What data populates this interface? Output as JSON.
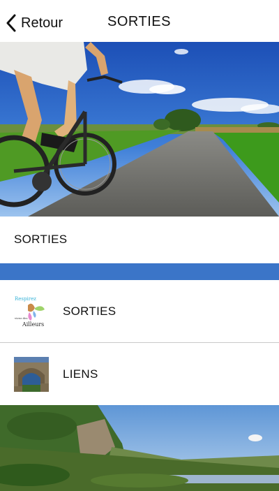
{
  "header": {
    "back_label": "Retour",
    "title": "SORTIES"
  },
  "section": {
    "label": "SORTIES"
  },
  "list": {
    "items": [
      {
        "label": "SORTIES",
        "thumb_word_top": "Respirez",
        "thumb_word_mid": "vivez des",
        "thumb_word_bottom": "Ailleurs"
      },
      {
        "label": "LIENS"
      }
    ]
  },
  "colors": {
    "accent_bar": "#3b75c8"
  },
  "icons": {
    "back": "chevron-left-icon"
  }
}
